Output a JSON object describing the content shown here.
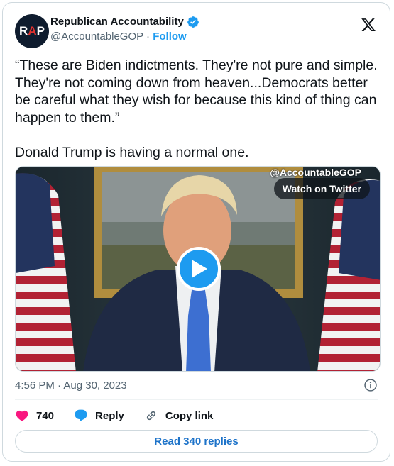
{
  "account": {
    "avatar_text_left": "R",
    "avatar_text_accent": "A",
    "avatar_text_right": "P",
    "display_name": "Republican Accountability",
    "handle": "@AccountableGOP",
    "separator": " · ",
    "follow_label": "Follow",
    "verified_color": "#1d9bf0"
  },
  "tweet": {
    "text": "“These are Biden indictments. They're not pure and simple. They're not coming down from heaven...Democrats better be careful what they wish for because this kind of thing can happen to them.”\n\nDonald Trump is having a normal one.",
    "timestamp": "4:56 PM · Aug 30, 2023"
  },
  "media": {
    "watermark": "@AccountableGOP",
    "watch_label": "Watch on Twitter",
    "play_icon": "play-icon"
  },
  "actions": {
    "likes_count": "740",
    "reply_label": "Reply",
    "copy_link_label": "Copy link",
    "read_replies_label": "Read 340 replies"
  },
  "colors": {
    "accent": "#1d9bf0",
    "like": "#f91880",
    "text_secondary": "#536471"
  }
}
